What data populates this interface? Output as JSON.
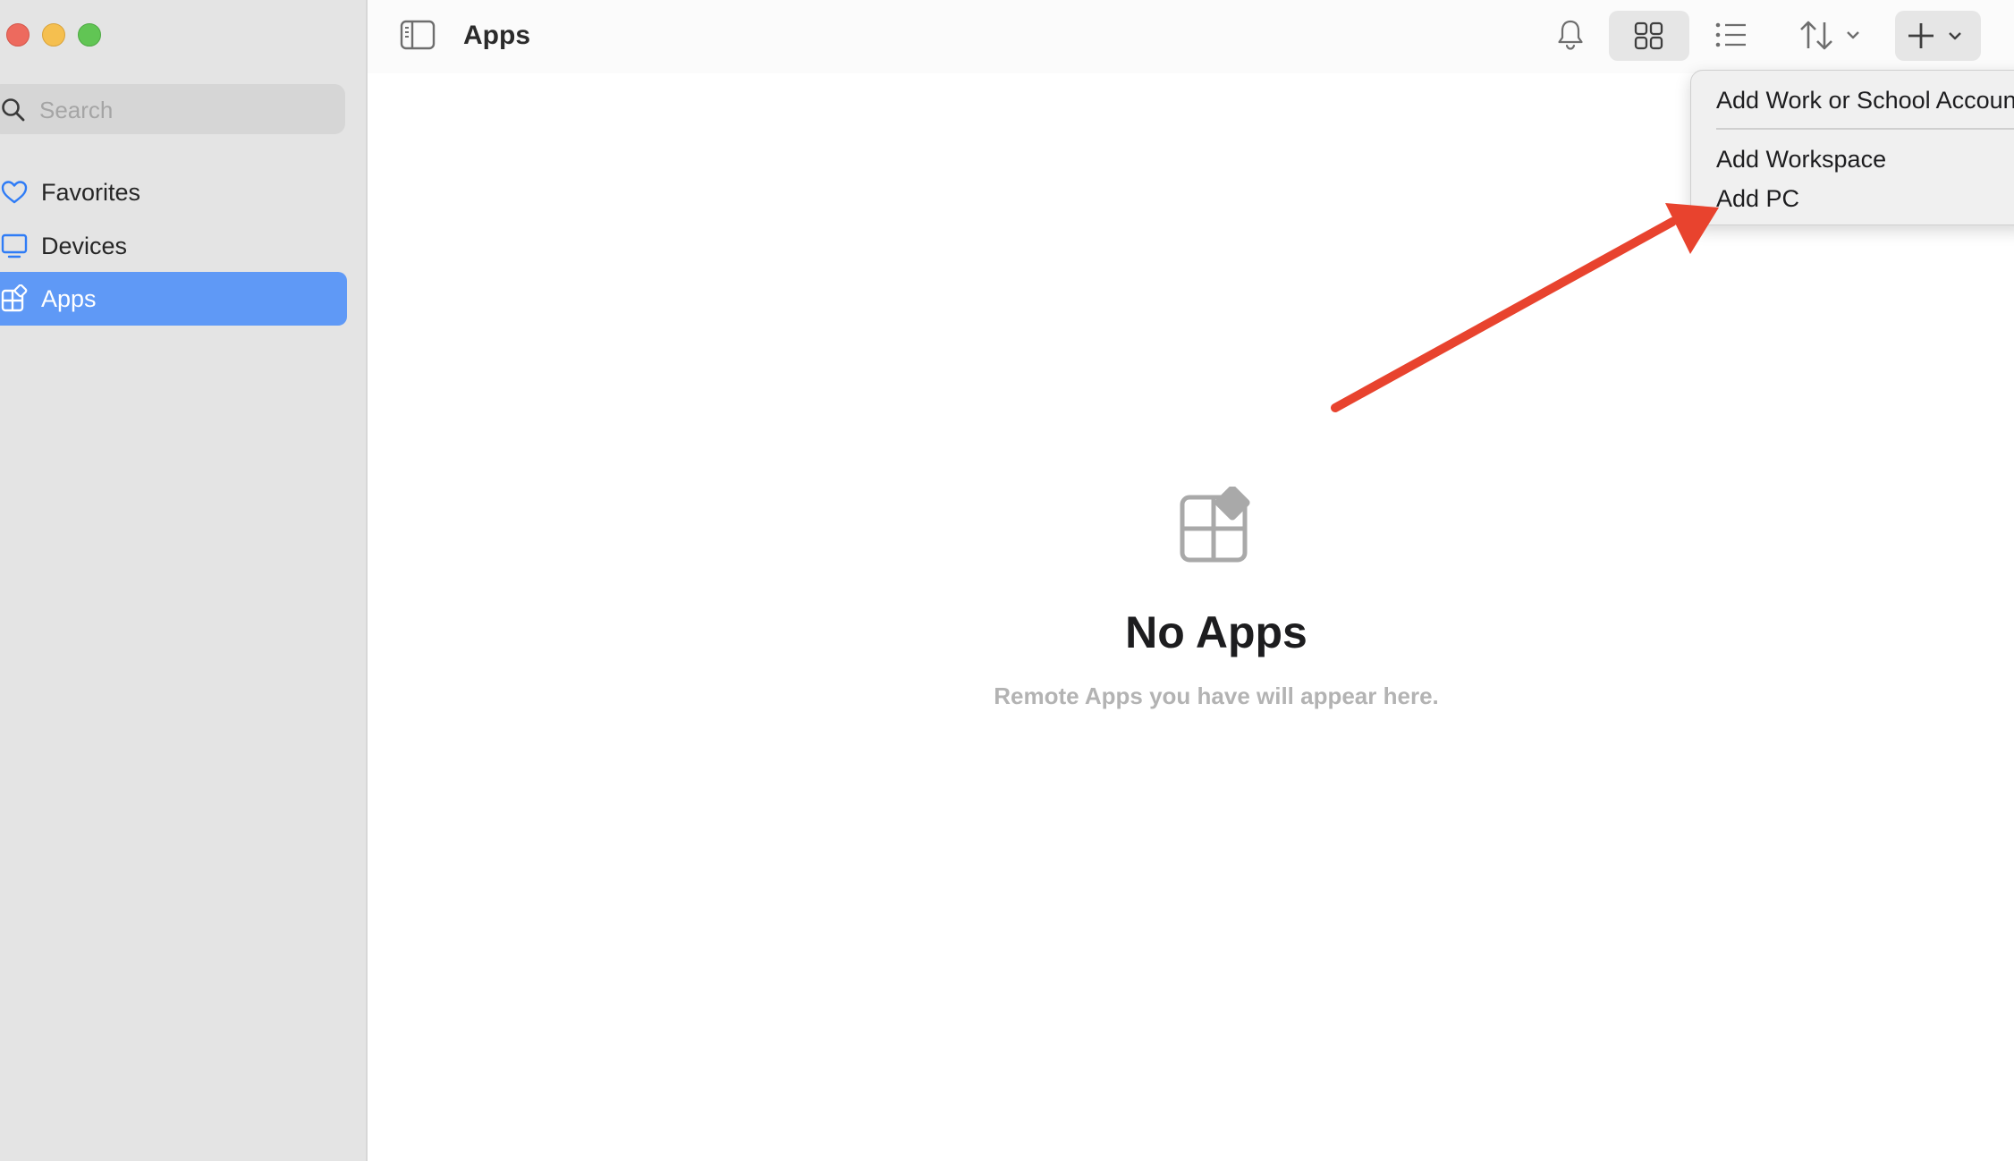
{
  "window": {
    "controls": [
      "close",
      "minimize",
      "zoom"
    ]
  },
  "sidebar": {
    "search": {
      "placeholder": "Search",
      "icon": "magnifying-glass-icon"
    },
    "items": [
      {
        "label": "Favorites",
        "icon": "heart-icon",
        "selected": false
      },
      {
        "label": "Devices",
        "icon": "monitor-icon",
        "selected": false
      },
      {
        "label": "Apps",
        "icon": "apps-grid-icon",
        "selected": true
      }
    ]
  },
  "toolbar": {
    "title": "Apps",
    "buttons": [
      "sidebar-toggle-icon",
      "bell-icon",
      "grid-view-icon",
      "list-view-icon",
      "sort-icon",
      "add-icon"
    ],
    "selected_view": "grid"
  },
  "empty_state": {
    "title": "No Apps",
    "subtitle": "Remote Apps you have will appear here."
  },
  "add_menu": {
    "items": [
      {
        "label": "Add Work or School Accoun"
      },
      {
        "label": "Add Workspace"
      },
      {
        "label": "Add PC"
      }
    ]
  },
  "annotation": {
    "type": "arrow",
    "color": "#e8432e",
    "points_to": "Add PC"
  },
  "colors": {
    "sidebar_bg": "#e4e4e4",
    "selection": "#5f99f6",
    "accent_icon": "#2f7cf6",
    "arrow": "#e8432e"
  }
}
